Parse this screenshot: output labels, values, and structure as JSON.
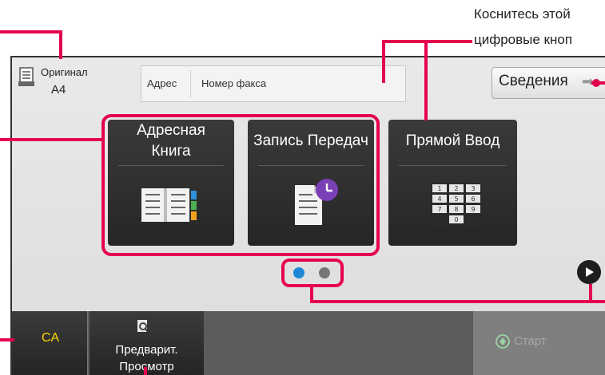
{
  "callout": {
    "line1": "Коснитесь этой",
    "line2": "цифровые кноп"
  },
  "header": {
    "original_label": "Оригинал",
    "original_value": "A4",
    "address_label": "Адрес",
    "address_field": "Номер факса",
    "info_button": "Сведения"
  },
  "tiles": [
    {
      "line1": "Адресная",
      "line2": "Книга",
      "icon": "address-book-icon"
    },
    {
      "line1": "Запись Передач",
      "line2": "",
      "icon": "transmission-log-icon"
    },
    {
      "line1": "Прямой Ввод",
      "line2": "",
      "icon": "keypad-icon"
    }
  ],
  "keypad": [
    "1",
    "2",
    "3",
    "4",
    "5",
    "6",
    "7",
    "8",
    "9",
    "0"
  ],
  "pagination": {
    "current": 1,
    "total": 2
  },
  "footer": {
    "ca_label": "CA",
    "preview_line1": "Предварит.",
    "preview_line2": "Просмотр",
    "start_label": "Старт"
  },
  "colors": {
    "accent": "#e5004f",
    "tile_bg": "#2e2e2e",
    "active_dot": "#1e88d6",
    "inactive_dot": "#777777",
    "ca_text": "#ffd800"
  }
}
